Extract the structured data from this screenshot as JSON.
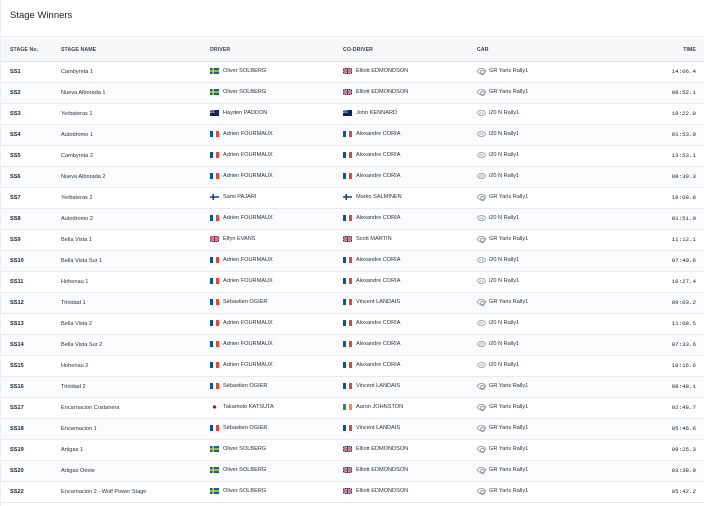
{
  "title": "Stage Winners",
  "headers": {
    "stage_no": "STAGE No.",
    "stage_name": "STAGE NAME",
    "driver": "DRIVER",
    "co_driver": "CO-DRIVER",
    "car": "CAR",
    "time": "TIME"
  },
  "flag_colors": {
    "SWE": [
      "#006aa7",
      "#fecc00"
    ],
    "GBR": [
      "#012169",
      "#c8102e"
    ],
    "NZL": [
      "#012169",
      "#cc142b"
    ],
    "FRA": [
      "#0055a4",
      "#ffffff",
      "#ef4135"
    ],
    "FIN": [
      "#ffffff",
      "#003580"
    ],
    "JPN": [
      "#ffffff",
      "#bc002d"
    ],
    "IRL": [
      "#169b62",
      "#ffffff",
      "#ff883e"
    ]
  },
  "rows": [
    {
      "stage": "SS1",
      "name": "Cambyreta 1",
      "driver": "Oliver SOLBERG",
      "driver_flag": "SWE",
      "co_driver": "Elliott EDMONDSON",
      "co_flag": "GBR",
      "car": "GR Yaris Rally1",
      "car_logo": "toyota-logo-icon",
      "time": "14:06.4"
    },
    {
      "stage": "SS2",
      "name": "Nueva Alborada 1",
      "driver": "Oliver SOLBERG",
      "driver_flag": "SWE",
      "co_driver": "Elliott EDMONDSON",
      "co_flag": "GBR",
      "car": "GR Yaris Rally1",
      "car_logo": "toyota-logo-icon",
      "time": "08:52.1"
    },
    {
      "stage": "SS3",
      "name": "Yerbateras 1",
      "driver": "Hayden PADDON",
      "driver_flag": "NZL",
      "co_driver": "John KENNARD",
      "co_flag": "NZL",
      "car": "i20 N Rally1",
      "car_logo": "hyundai-logo-icon",
      "time": "19:22.0"
    },
    {
      "stage": "SS4",
      "name": "Autodromo 1",
      "driver": "Adrien FOURMAUX",
      "driver_flag": "FRA",
      "co_driver": "Alexandre CORIA",
      "co_flag": "FRA",
      "car": "i20 N Rally1",
      "car_logo": "hyundai-logo-icon",
      "time": "01:53.0"
    },
    {
      "stage": "SS5",
      "name": "Cambyreta 2",
      "driver": "Adrien FOURMAUX",
      "driver_flag": "FRA",
      "co_driver": "Alexandre CORIA",
      "co_flag": "FRA",
      "car": "i20 N Rally1",
      "car_logo": "hyundai-logo-icon",
      "time": "13:53.1"
    },
    {
      "stage": "SS6",
      "name": "Nueva Alborada 2",
      "driver": "Adrien FOURMAUX",
      "driver_flag": "FRA",
      "co_driver": "Alexandre CORIA",
      "co_flag": "FRA",
      "car": "i20 N Rally1",
      "car_logo": "hyundai-logo-icon",
      "time": "08:39.3"
    },
    {
      "stage": "SS7",
      "name": "Yerbateras 2",
      "driver": "Sami PAJARI",
      "driver_flag": "FIN",
      "co_driver": "Marko SALMINEN",
      "co_flag": "FIN",
      "car": "GR Yaris Rally1",
      "car_logo": "toyota-logo-icon",
      "time": "19:08.8"
    },
    {
      "stage": "SS8",
      "name": "Autodromo 2",
      "driver": "Adrien FOURMAUX",
      "driver_flag": "FRA",
      "co_driver": "Alexandre CORIA",
      "co_flag": "FRA",
      "car": "i20 N Rally1",
      "car_logo": "hyundai-logo-icon",
      "time": "01:51.0"
    },
    {
      "stage": "SS9",
      "name": "Bella Vista 1",
      "driver": "Elfyn EVANS",
      "driver_flag": "GBR",
      "co_driver": "Scott MARTIN",
      "co_flag": "GBR",
      "car": "GR Yaris Rally1",
      "car_logo": "toyota-logo-icon",
      "time": "11:12.1"
    },
    {
      "stage": "SS10",
      "name": "Bella Vista Sur 1",
      "driver": "Adrien FOURMAUX",
      "driver_flag": "FRA",
      "co_driver": "Alexandre CORIA",
      "co_flag": "FRA",
      "car": "i20 N Rally1",
      "car_logo": "hyundai-logo-icon",
      "time": "07:40.6"
    },
    {
      "stage": "SS11",
      "name": "Hohenau 1",
      "driver": "Adrien FOURMAUX",
      "driver_flag": "FRA",
      "co_driver": "Alexandre CORIA",
      "co_flag": "FRA",
      "car": "i20 N Rally1",
      "car_logo": "hyundai-logo-icon",
      "time": "10:27.4"
    },
    {
      "stage": "SS12",
      "name": "Trinidad 1",
      "driver": "Sébastien OGIER",
      "driver_flag": "FRA",
      "co_driver": "Vincent LANDAIS",
      "co_flag": "FRA",
      "car": "GR Yaris Rally1",
      "car_logo": "toyota-logo-icon",
      "time": "09:03.2"
    },
    {
      "stage": "SS13",
      "name": "Bella Vista 2",
      "driver": "Adrien FOURMAUX",
      "driver_flag": "FRA",
      "co_driver": "Alexandre CORIA",
      "co_flag": "FRA",
      "car": "i20 N Rally1",
      "car_logo": "hyundai-logo-icon",
      "time": "11:08.5"
    },
    {
      "stage": "SS14",
      "name": "Bella Vista Sur 2",
      "driver": "Adrien FOURMAUX",
      "driver_flag": "FRA",
      "co_driver": "Alexandre CORIA",
      "co_flag": "FRA",
      "car": "i20 N Rally1",
      "car_logo": "hyundai-logo-icon",
      "time": "07:33.6"
    },
    {
      "stage": "SS15",
      "name": "Hohenau 2",
      "driver": "Adrien FOURMAUX",
      "driver_flag": "FRA",
      "co_driver": "Alexandre CORIA",
      "co_flag": "FRA",
      "car": "i20 N Rally1",
      "car_logo": "hyundai-logo-icon",
      "time": "10:16.6"
    },
    {
      "stage": "SS16",
      "name": "Trinidad 2",
      "driver": "Sébastien OGIER",
      "driver_flag": "FRA",
      "co_driver": "Vincent LANDAIS",
      "co_flag": "FRA",
      "car": "GR Yaris Rally1",
      "car_logo": "toyota-logo-icon",
      "time": "08:48.1"
    },
    {
      "stage": "SS17",
      "name": "Encarnacion Costanera",
      "driver": "Takamoto KATSUTA",
      "driver_flag": "JPN",
      "co_driver": "Aaron JOHNSTON",
      "co_flag": "IRL",
      "car": "GR Yaris Rally1",
      "car_logo": "toyota-logo-icon",
      "time": "02:48.7"
    },
    {
      "stage": "SS18",
      "name": "Encarnacion 1",
      "driver": "Sébastien OGIER",
      "driver_flag": "FRA",
      "co_driver": "Vincent LANDAIS",
      "co_flag": "FRA",
      "car": "GR Yaris Rally1",
      "car_logo": "toyota-logo-icon",
      "time": "05:46.6"
    },
    {
      "stage": "SS19",
      "name": "Artigas 1",
      "driver": "Oliver SOLBERG",
      "driver_flag": "SWE",
      "co_driver": "Elliott EDMONDSON",
      "co_flag": "GBR",
      "car": "GR Yaris Rally1",
      "car_logo": "toyota-logo-icon",
      "time": "09:25.3"
    },
    {
      "stage": "SS20",
      "name": "Artigas Oeste",
      "driver": "Oliver SOLBERG",
      "driver_flag": "SWE",
      "co_driver": "Elliott EDMONDSON",
      "co_flag": "GBR",
      "car": "GR Yaris Rally1",
      "car_logo": "toyota-logo-icon",
      "time": "03:38.9"
    },
    {
      "stage": "SS22",
      "name": "Encarnacion 2 - Wolf Power Stage",
      "driver": "Oliver SOLBERG",
      "driver_flag": "SWE",
      "co_driver": "Elliott EDMONDSON",
      "co_flag": "GBR",
      "car": "GR Yaris Rally1",
      "car_logo": "toyota-logo-icon",
      "time": "05:42.2"
    }
  ]
}
